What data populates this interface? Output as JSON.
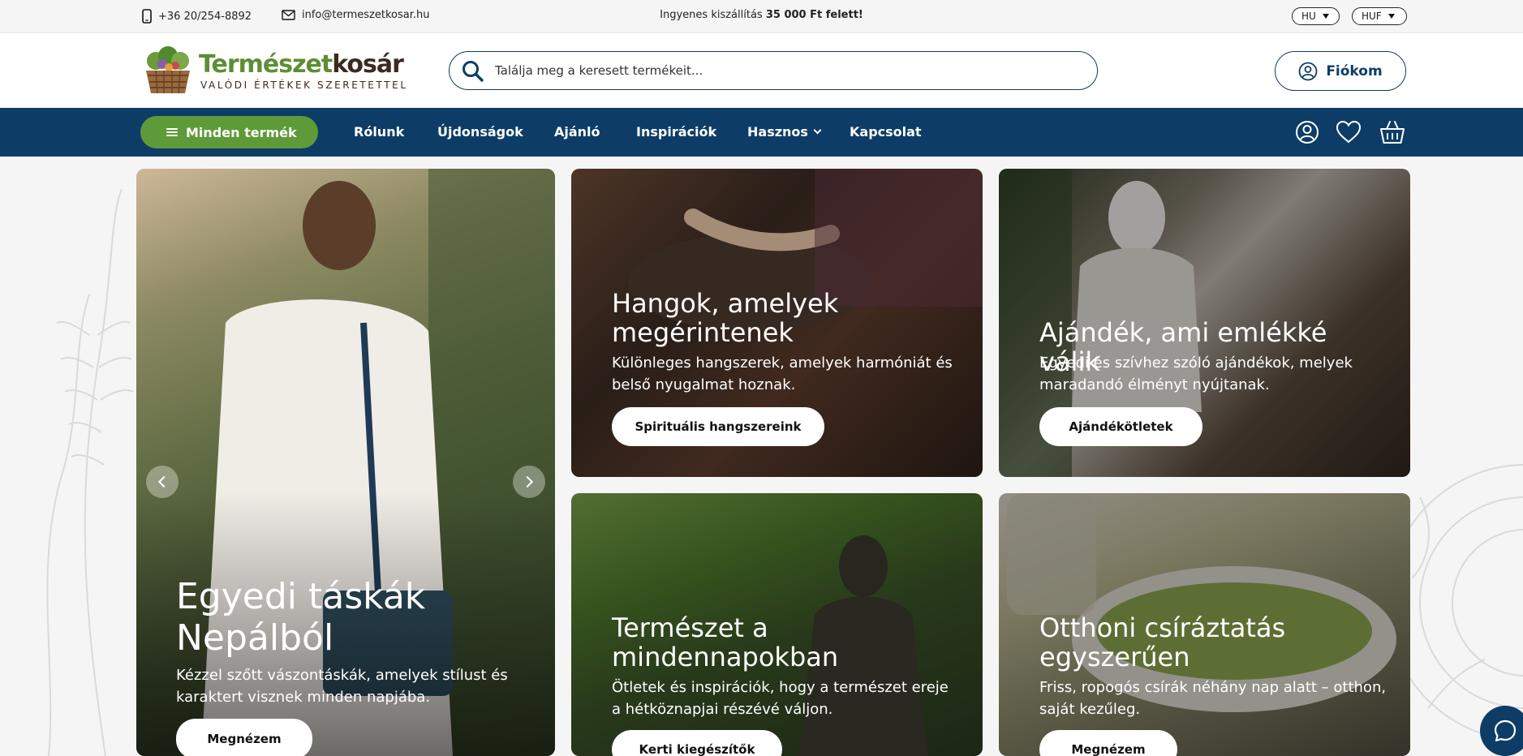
{
  "topbar": {
    "phone": "+36 20/254-8892",
    "email": "info@termeszetkosar.hu",
    "shipping_prefix": "Ingyenes kiszállítás ",
    "shipping_amount": "35 000 Ft felett!",
    "language": "HU",
    "currency": "HUF"
  },
  "header": {
    "brand_part1": "Természet",
    "brand_part2": "kosár",
    "tagline": "VALÓDI ÉRTÉKEK SZERETETTEL",
    "search_placeholder": "Találja meg a keresett termékeit...",
    "account_label": "Fiókom"
  },
  "nav": {
    "all_products": "Minden termék",
    "items": [
      "Rólunk",
      "Újdonságok",
      "Ajánló",
      "Inspirációk",
      "Hasznos",
      "Kapcsolat"
    ]
  },
  "cards": {
    "main": {
      "title": "Egyedi táskák Nepálból",
      "text": "Kézzel szőtt vászontáskák, amelyek stílust és karaktert visznek minden napjába.",
      "cta": "Megnézem"
    },
    "sounds": {
      "title": "Hangok, amelyek megérintenek",
      "text": "Különleges hangszerek, amelyek harmóniát és belső nyugalmat hoznak.",
      "cta": "Spirituális hangszereink"
    },
    "gift": {
      "title": "Ajándék, ami emlékké válik",
      "text": "Egyedi és szívhez szóló ajándékok, melyek maradandó élményt nyújtanak.",
      "cta": "Ajándékötletek"
    },
    "nature": {
      "title": "Természet a mindennapokban",
      "text": "Ötletek és inspirációk, hogy a természet ereje a hétköznapjai részévé váljon.",
      "cta": "Kerti kiegészítők"
    },
    "sprouts": {
      "title": "Otthoni csíráztatás egyszerűen",
      "text": "Friss, ropogós csírák néhány nap alatt – otthon, saját kezűleg.",
      "cta": "Megnézem"
    }
  },
  "colors": {
    "primary": "#0d3d66",
    "green": "#5f9a38",
    "brand_brown": "#3d2a1f"
  }
}
